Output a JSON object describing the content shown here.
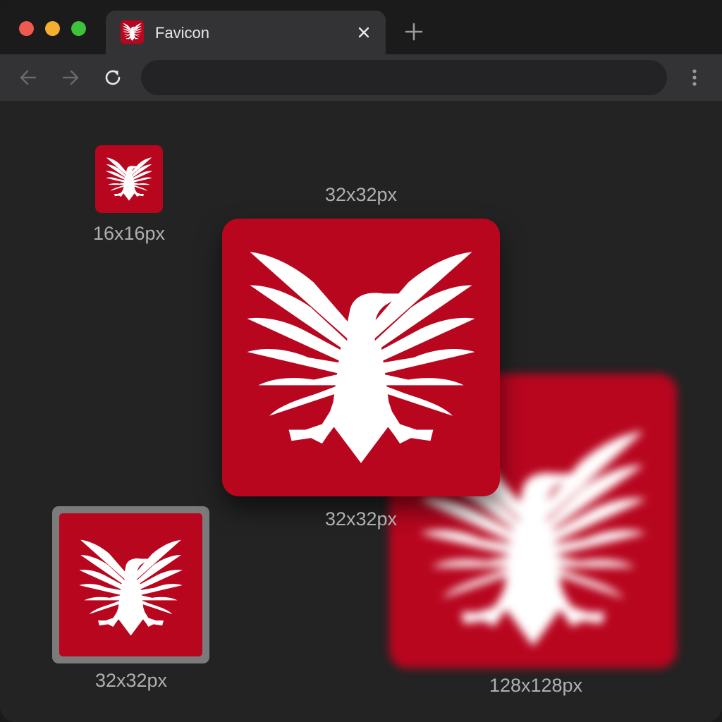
{
  "colors": {
    "favicon_red": "#b8061f",
    "emblem_white": "#ffffff",
    "traffic_red": "#ef5a50",
    "traffic_yellow": "#f4b12e",
    "traffic_green": "#3ec13b",
    "icon_gray": "#9a9a9a",
    "icon_light": "#e8e8e8"
  },
  "tab": {
    "title": "Favicon",
    "favicon_icon": "eagle-icon",
    "close_icon": "close-icon"
  },
  "newtab_icon": "plus-icon",
  "toolbar": {
    "back_icon": "arrow-left-icon",
    "forward_icon": "arrow-right-icon",
    "reload_icon": "reload-icon",
    "address_value": "",
    "menu_icon": "vertical-dots-icon"
  },
  "previews": {
    "label_16": "16x16px",
    "label_32_top": "32x32px",
    "label_32_mid": "32x32px",
    "label_32_bottom": "32x32px",
    "label_128": "128x128px",
    "icon": "eagle-icon"
  }
}
